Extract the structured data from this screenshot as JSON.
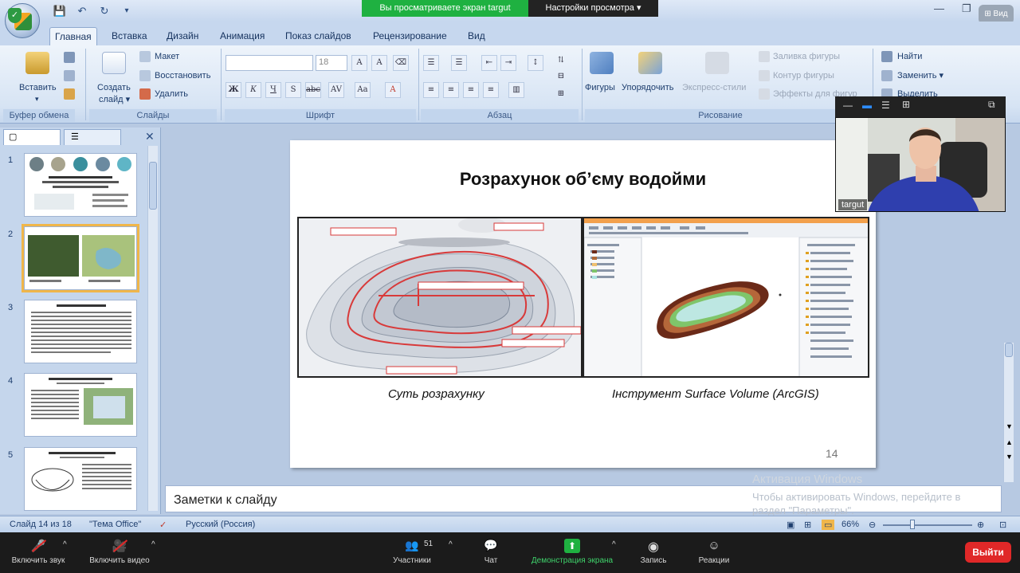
{
  "share_banner": {
    "viewing_text": "Вы просматриваете экран targut",
    "view_settings": "Настройки просмотра ▾"
  },
  "zoom_pill": "⊞  ",
  "tabs": [
    "Главная",
    "Вставка",
    "Дизайн",
    "Анимация",
    "Показ слайдов",
    "Рецензирование",
    "Вид"
  ],
  "ribbon": {
    "clipboard": {
      "paste": "Вставить",
      "label": "Буфер обмена"
    },
    "slides": {
      "new_slide": "Создать",
      "new_slide2": "слайд",
      "layout": "Макет",
      "reset": "Восстановить",
      "delete": "Удалить",
      "label": "Слайды"
    },
    "font": {
      "size": "18",
      "label": "Шрифт"
    },
    "paragraph": {
      "label": "Абзац"
    },
    "drawing": {
      "shapes": "Фигуры",
      "arrange": "Упорядочить",
      "styles": "Экспресс-стили",
      "fill": "Заливка фигуры",
      "outline": "Контур фигуры",
      "effects": "Эффекты для фигур",
      "label": "Рисование"
    },
    "editing": {
      "find": "Найти",
      "replace": "Заменить",
      "select": "Выделить"
    }
  },
  "thumbnails": [
    "1",
    "2",
    "3",
    "4",
    "5"
  ],
  "slide": {
    "title": "Розрахунок об’єму водойми",
    "caption_left": "Суть розрахунку",
    "caption_right": "Інструмент Surface Volume (ArcGIS)",
    "number": "14"
  },
  "notes_placeholder": "Заметки к слайду",
  "windows_activation": {
    "title": "Активация Windows",
    "body": "Чтобы активировать Windows, перейдите в раздел \"Параметры\"."
  },
  "statusbar": {
    "slide_info": "Слайд 14 из 18",
    "theme": "\"Тема Office\"",
    "language": "Русский (Россия)",
    "zoom": "66%"
  },
  "webcam": {
    "name": "targut"
  },
  "zoom_toolbar": {
    "mute": "Включить звук",
    "video": "Включить видео",
    "participants": "Участники",
    "participants_count": "51",
    "chat": "Чат",
    "share": "Демонстрация экрана",
    "record": "Запись",
    "reactions": "Реакции",
    "leave": "Выйти"
  },
  "colors": {
    "ribbon": "#dfe9f7",
    "share_green": "#1fb141",
    "leave_red": "#e02828",
    "thumb_selected": "#f0b64a"
  }
}
